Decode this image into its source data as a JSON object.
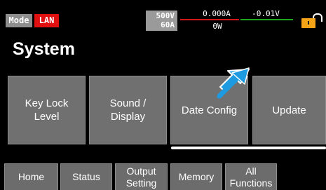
{
  "status_bar": {
    "mode_label": "Mode",
    "lan_label": "LAN",
    "voltage_rating": "500V",
    "current_rating": "60A",
    "measured_current": "0.000A",
    "measured_voltage": "-0.01V",
    "measured_power": "0W",
    "lock_icon": "lock-icon"
  },
  "page": {
    "title": "System"
  },
  "tiles": [
    {
      "label": "Key Lock\nLevel"
    },
    {
      "label": "Sound /\nDisplay"
    },
    {
      "label": "Date Config"
    },
    {
      "label": "Update"
    }
  ],
  "tabs": [
    {
      "label": "Home"
    },
    {
      "label": "Status"
    },
    {
      "label": "Output\nSetting"
    },
    {
      "label": "Memory"
    },
    {
      "label": "All\nFunctions"
    }
  ],
  "colors": {
    "background": "#000000",
    "tile": "#707070",
    "lan": "#e01010",
    "lock": "#f4a416",
    "arrow": "#1e9be0",
    "current_rule": "#d01818",
    "voltage_rule": "#1ea61e"
  }
}
